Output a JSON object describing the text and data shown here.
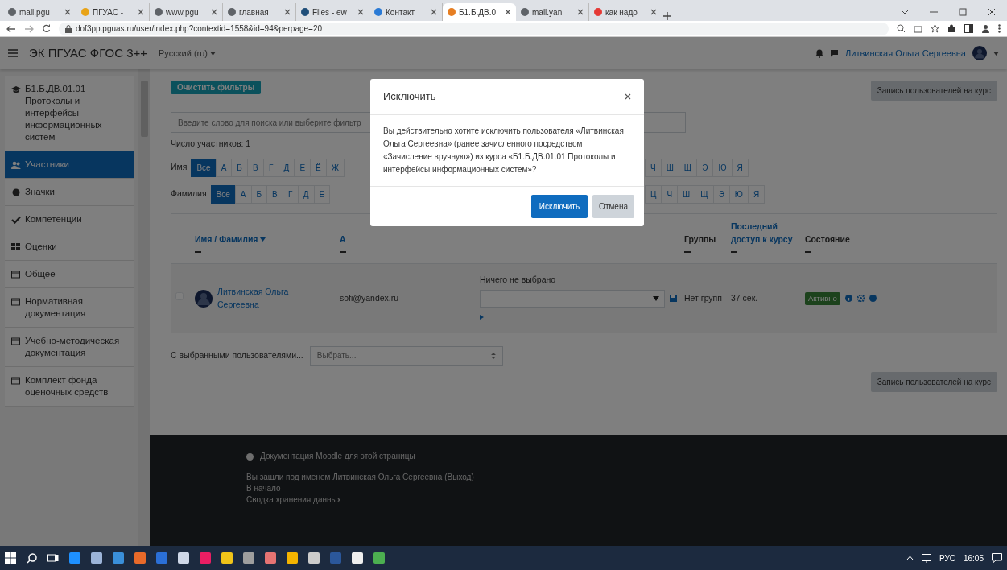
{
  "browser": {
    "tabs": [
      {
        "label": "mail.pgu",
        "selected": false,
        "color": "#5f6368"
      },
      {
        "label": "ПГУАС -",
        "selected": false,
        "color": "#e8a317"
      },
      {
        "label": "www.pgu",
        "selected": false,
        "color": "#5f6368"
      },
      {
        "label": "главная",
        "selected": false,
        "color": "#5f6368"
      },
      {
        "label": "Files - ew",
        "selected": false,
        "color": "#1f4e79"
      },
      {
        "label": "Контакт",
        "selected": false,
        "color": "#2a7ad5"
      },
      {
        "label": "Б1.Б.ДВ.0",
        "selected": true,
        "color": "#e67e22"
      },
      {
        "label": "mail.yan",
        "selected": false,
        "color": "#5f6368"
      },
      {
        "label": "как надо",
        "selected": false,
        "color": "#e53935"
      }
    ],
    "address": "dof3pp.pguas.ru/user/index.php?contextid=1558&id=94&perpage=20"
  },
  "navbar": {
    "site_name": "ЭК ПГУАС ФГОС 3++",
    "language": "Русский (ru)",
    "user_name": "Литвинская Ольга Сергеевна"
  },
  "sidebar": {
    "items": [
      {
        "label": "Б1.Б.ДВ.01.01 Протоколы и интерфейсы информационных систем",
        "kind": "course",
        "selected": false
      },
      {
        "label": "Участники",
        "kind": "users",
        "selected": true
      },
      {
        "label": "Значки",
        "kind": "badges",
        "selected": false
      },
      {
        "label": "Компетенции",
        "kind": "competencies",
        "selected": false
      },
      {
        "label": "Оценки",
        "kind": "grades",
        "selected": false
      },
      {
        "label": "Общее",
        "kind": "section",
        "selected": false
      },
      {
        "label": "Нормативная документация",
        "kind": "section",
        "selected": false
      },
      {
        "label": "Учебно-методическая документация",
        "kind": "section",
        "selected": false
      },
      {
        "label": "Комплект фонда оценочных средств",
        "kind": "section",
        "selected": false
      }
    ]
  },
  "main": {
    "filter_button": "Очистить фильтры",
    "enrol_button_top": "Запись пользователей на курс",
    "search": {
      "placeholder": "Введите слово для поиска или выберите фильтр"
    },
    "participant_count": "Число участников: 1",
    "initials": [
      {
        "label": "Имя",
        "left": [
          {
            "text": "Все",
            "selected": true
          },
          {
            "text": "А",
            "selected": false
          },
          {
            "text": "Б",
            "selected": false
          },
          {
            "text": "В",
            "selected": false
          },
          {
            "text": "Г",
            "selected": false
          },
          {
            "text": "Д",
            "selected": false
          },
          {
            "text": "Е",
            "selected": false
          },
          {
            "text": "Ё",
            "selected": false
          },
          {
            "text": "Ж",
            "selected": false
          }
        ],
        "right": [
          {
            "text": "Ч",
            "selected": false
          },
          {
            "text": "Ш",
            "selected": false
          },
          {
            "text": "Щ",
            "selected": false
          },
          {
            "text": "Э",
            "selected": false
          },
          {
            "text": "Ю",
            "selected": false
          },
          {
            "text": "Я",
            "selected": false
          }
        ]
      },
      {
        "label": "Фамилия",
        "left": [
          {
            "text": "Все",
            "selected": true
          },
          {
            "text": "А",
            "selected": false
          },
          {
            "text": "Б",
            "selected": false
          },
          {
            "text": "В",
            "selected": false
          },
          {
            "text": "Г",
            "selected": false
          },
          {
            "text": "Д",
            "selected": false
          },
          {
            "text": "Е",
            "selected": false
          }
        ],
        "right": [
          {
            "text": "Ц",
            "selected": false
          },
          {
            "text": "Ч",
            "selected": false
          },
          {
            "text": "Ш",
            "selected": false
          },
          {
            "text": "Щ",
            "selected": false
          },
          {
            "text": "Э",
            "selected": false
          },
          {
            "text": "Ю",
            "selected": false
          },
          {
            "text": "Я",
            "selected": false
          }
        ]
      }
    ],
    "table": {
      "columns": [
        {
          "label": "Имя / Фамилия",
          "sortable": true,
          "sorted": true
        },
        {
          "label": "А",
          "sortable": true,
          "sorted": false
        },
        {
          "label": "Группы",
          "sortable": false,
          "sorted": false
        },
        {
          "label": "Последний доступ к курсу",
          "sortable": true,
          "sorted": false
        },
        {
          "label": "Состояние",
          "sortable": false,
          "sorted": false
        }
      ],
      "rows": [
        {
          "name": "Литвинская Ольга Сергеевна",
          "email": "sofi@yandex.ru",
          "roles_text": "Ничего не выбрано",
          "groups": "Нет групп",
          "last_access": "37 сек.",
          "status": "Активно",
          "checked": false
        }
      ]
    },
    "bulk_label": "С выбранными пользователями...",
    "bulk_select": "Выбрать...",
    "enrol_button_bottom": "Запись пользователей на курс"
  },
  "footer": {
    "doc_link": "Документация Moodle для этой страницы",
    "logged_in_prefix": "Вы зашли под именем",
    "logged_in_user": "Литвинская Ольга Сергеевна",
    "logout": "(Выход)",
    "home": "В начало",
    "data_summary": "Сводка хранения данных"
  },
  "modal": {
    "title": "Исключить",
    "body": "Вы действительно хотите исключить пользователя «Литвинская Ольга Сергеевна» (ранее зачисленного посредством «Зачисление вручную») из курса «Б1.Б.ДВ.01.01 Протоколы и интерфейсы информационных систем»?",
    "confirm": "Исключить",
    "cancel": "Отмена"
  },
  "taskbar": {
    "language": "РУС",
    "time": "16:05"
  }
}
